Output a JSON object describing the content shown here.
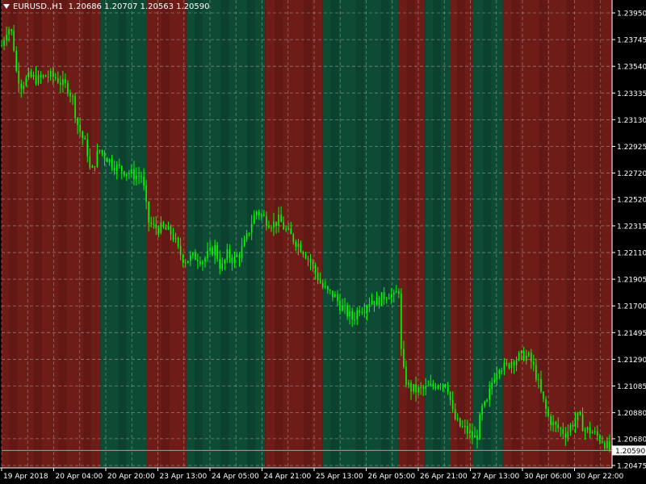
{
  "header": {
    "symbol_timeframe": "EURUSD.,H1",
    "ohlc": "1.20686 1.20707 1.20563 1.20590"
  },
  "colors": {
    "background": "#000000",
    "candle": "#00ff00",
    "grid": "#c0c0c0",
    "bear_zone": "#6e1c18",
    "bear_zone_dark": "#5a1612",
    "bull_zone": "#0e4b35",
    "bull_zone_dark": "#0a3b28",
    "axis_text": "#ffffff",
    "bid_line": "#a0a0a0"
  },
  "chart_data": {
    "type": "candlestick",
    "symbol": "EURUSD.",
    "timeframe": "H1",
    "y_ticks": [
      "1.23950",
      "1.23745",
      "1.23540",
      "1.23335",
      "1.23130",
      "1.22925",
      "1.22720",
      "1.22520",
      "1.22315",
      "1.22110",
      "1.21905",
      "1.21700",
      "1.21495",
      "1.21290",
      "1.21085",
      "1.20880",
      "1.20680",
      "1.20475"
    ],
    "ylim": [
      1.20475,
      1.2395
    ],
    "current_price": "1.20590",
    "x_ticks": [
      "19 Apr 2018",
      "20 Apr 04:00",
      "20 Apr 20:00",
      "23 Apr 13:00",
      "24 Apr 05:00",
      "24 Apr 21:00",
      "25 Apr 13:00",
      "26 Apr 05:00",
      "26 Apr 21:00",
      "27 Apr 13:00",
      "30 Apr 06:00",
      "30 Apr 22:00"
    ],
    "zones": [
      {
        "from": 0,
        "to": 0.1618,
        "trend": "bear"
      },
      {
        "from": 0.1618,
        "to": 0.2368,
        "trend": "bull"
      },
      {
        "from": 0.2368,
        "to": 0.3026,
        "trend": "bear"
      },
      {
        "from": 0.3026,
        "to": 0.4316,
        "trend": "bull"
      },
      {
        "from": 0.4316,
        "to": 0.5263,
        "trend": "bear"
      },
      {
        "from": 0.5263,
        "to": 0.65,
        "trend": "bull"
      },
      {
        "from": 0.65,
        "to": 0.6934,
        "trend": "bear"
      },
      {
        "from": 0.6934,
        "to": 0.7355,
        "trend": "bull"
      },
      {
        "from": 0.7355,
        "to": 0.7724,
        "trend": "bear"
      },
      {
        "from": 0.7724,
        "to": 0.8211,
        "trend": "bull"
      },
      {
        "from": 0.8211,
        "to": 1.0,
        "trend": "bear"
      }
    ],
    "path": [
      [
        0.0,
        1.237
      ],
      [
        0.01,
        1.2385
      ],
      [
        0.018,
        1.2378
      ],
      [
        0.024,
        1.235
      ],
      [
        0.032,
        1.234
      ],
      [
        0.045,
        1.2346
      ],
      [
        0.06,
        1.2344
      ],
      [
        0.075,
        1.2347
      ],
      [
        0.09,
        1.2345
      ],
      [
        0.1,
        1.234
      ],
      [
        0.108,
        1.2338
      ],
      [
        0.116,
        1.233
      ],
      [
        0.124,
        1.231
      ],
      [
        0.132,
        1.23
      ],
      [
        0.14,
        1.229
      ],
      [
        0.146,
        1.227
      ],
      [
        0.152,
        1.228
      ],
      [
        0.16,
        1.229
      ],
      [
        0.17,
        1.2285
      ],
      [
        0.18,
        1.228
      ],
      [
        0.19,
        1.2276
      ],
      [
        0.2,
        1.2274
      ],
      [
        0.21,
        1.2272
      ],
      [
        0.22,
        1.227
      ],
      [
        0.23,
        1.227
      ],
      [
        0.24,
        1.2235
      ],
      [
        0.25,
        1.223
      ],
      [
        0.26,
        1.223
      ],
      [
        0.27,
        1.2228
      ],
      [
        0.28,
        1.2225
      ],
      [
        0.29,
        1.2212
      ],
      [
        0.3,
        1.2205
      ],
      [
        0.31,
        1.2207
      ],
      [
        0.32,
        1.2208
      ],
      [
        0.33,
        1.2205
      ],
      [
        0.34,
        1.221
      ],
      [
        0.35,
        1.2215
      ],
      [
        0.355,
        1.2205
      ],
      [
        0.36,
        1.2198
      ],
      [
        0.37,
        1.221
      ],
      [
        0.38,
        1.2205
      ],
      [
        0.39,
        1.221
      ],
      [
        0.4,
        1.222
      ],
      [
        0.41,
        1.2235
      ],
      [
        0.418,
        1.2243
      ],
      [
        0.425,
        1.224
      ],
      [
        0.435,
        1.2235
      ],
      [
        0.445,
        1.2233
      ],
      [
        0.455,
        1.2236
      ],
      [
        0.465,
        1.2228
      ],
      [
        0.475,
        1.2223
      ],
      [
        0.485,
        1.2218
      ],
      [
        0.495,
        1.2212
      ],
      [
        0.505,
        1.2205
      ],
      [
        0.515,
        1.2195
      ],
      [
        0.525,
        1.2185
      ],
      [
        0.535,
        1.218
      ],
      [
        0.545,
        1.2178
      ],
      [
        0.555,
        1.217
      ],
      [
        0.565,
        1.2165
      ],
      [
        0.575,
        1.216
      ],
      [
        0.585,
        1.2168
      ],
      [
        0.595,
        1.217
      ],
      [
        0.605,
        1.2175
      ],
      [
        0.615,
        1.2173
      ],
      [
        0.625,
        1.2177
      ],
      [
        0.635,
        1.218
      ],
      [
        0.645,
        1.2175
      ],
      [
        0.65,
        1.219
      ],
      [
        0.655,
        1.213
      ],
      [
        0.66,
        1.2115
      ],
      [
        0.668,
        1.2107
      ],
      [
        0.68,
        1.2105
      ],
      [
        0.692,
        1.2106
      ],
      [
        0.705,
        1.2108
      ],
      [
        0.718,
        1.2112
      ],
      [
        0.73,
        1.211
      ],
      [
        0.74,
        1.2085
      ],
      [
        0.75,
        1.2078
      ],
      [
        0.76,
        1.2075
      ],
      [
        0.77,
        1.207
      ],
      [
        0.778,
        1.2068
      ],
      [
        0.786,
        1.209
      ],
      [
        0.795,
        1.2095
      ],
      [
        0.805,
        1.2115
      ],
      [
        0.815,
        1.2125
      ],
      [
        0.825,
        1.2122
      ],
      [
        0.835,
        1.2128
      ],
      [
        0.845,
        1.213
      ],
      [
        0.855,
        1.2132
      ],
      [
        0.865,
        1.213
      ],
      [
        0.875,
        1.2118
      ],
      [
        0.885,
        1.21
      ],
      [
        0.895,
        1.2085
      ],
      [
        0.905,
        1.2078
      ],
      [
        0.915,
        1.2075
      ],
      [
        0.925,
        1.2072
      ],
      [
        0.935,
        1.208
      ],
      [
        0.945,
        1.2085
      ],
      [
        0.955,
        1.2075
      ],
      [
        0.965,
        1.2074
      ],
      [
        0.975,
        1.207
      ],
      [
        0.985,
        1.2067
      ],
      [
        0.995,
        1.206
      ],
      [
        1.0,
        1.2059
      ]
    ]
  }
}
